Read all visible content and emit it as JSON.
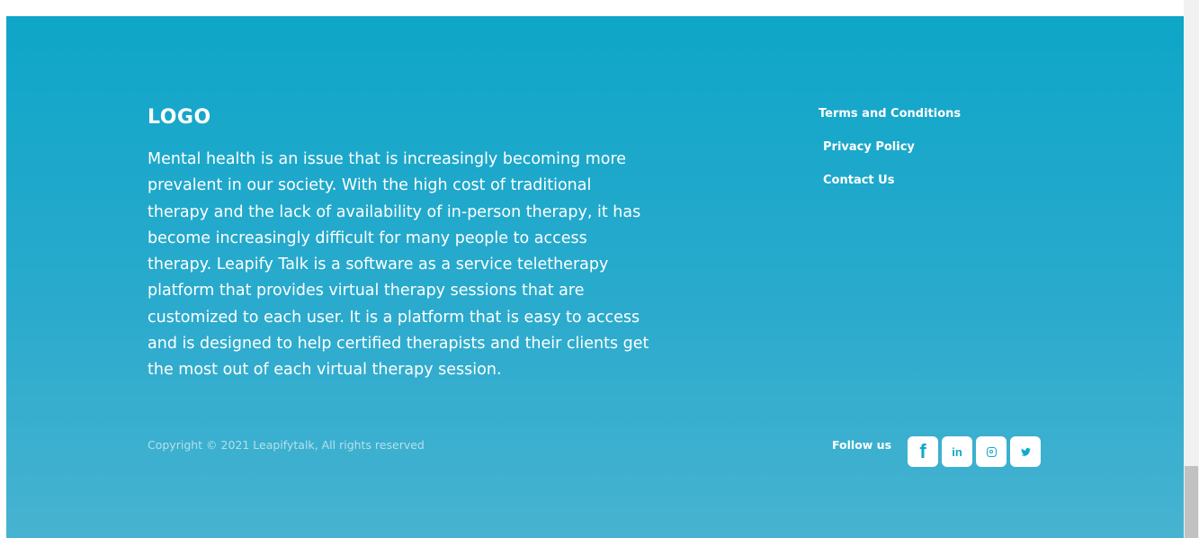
{
  "footer": {
    "logo": "LOGO",
    "description": "Mental health is an issue that is increasingly becoming more prevalent in our society. With the high cost of traditional therapy and the lack of availability of in-person therapy, it has become increasingly difficult for many people to access therapy. Leapify Talk is a software as a service teletherapy platform that provides virtual therapy sessions that are customized to each user. It is a platform that is easy to access and is designed to help certified therapists and their clients get the most out of each virtual therapy session.",
    "copyright": "Copyright © 2021 Leapifytalk, All rights reserved",
    "links": [
      {
        "label": "Terms and Conditions"
      },
      {
        "label": "Privacy Policy"
      },
      {
        "label": "Contact Us"
      }
    ],
    "follow_label": "Follow us",
    "social": [
      {
        "icon": "facebook-icon",
        "glyph": "f"
      },
      {
        "icon": "linkedin-icon",
        "glyph": "in"
      },
      {
        "icon": "instagram-icon"
      },
      {
        "icon": "twitter-icon",
        "glyph": "🐦"
      }
    ]
  },
  "colors": {
    "gradient_top": "#0ea6c8",
    "gradient_bottom": "#47b3d0",
    "text": "#ffffff",
    "icon": "#0fa7cb"
  }
}
